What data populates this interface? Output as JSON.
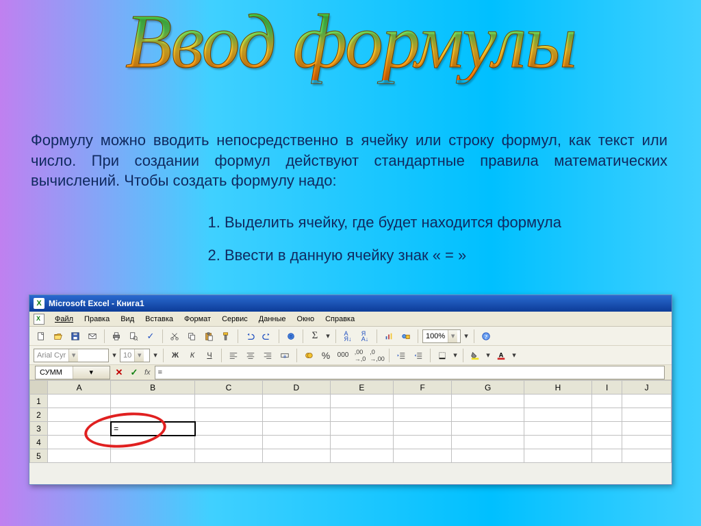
{
  "slide": {
    "title": "Ввод формулы",
    "paragraph": "Формулу можно вводить непосредственно в ячейку или строку формул, как текст или число. При создании формул действуют стандартные правила математических вычислений. Чтобы создать формулу надо:",
    "list": [
      "Выделить ячейку, где будет находится формула",
      "Ввести в данную ячейку знак « = »"
    ]
  },
  "excel": {
    "title": "Microsoft Excel - Книга1",
    "menu": [
      "Файл",
      "Правка",
      "Вид",
      "Вставка",
      "Формат",
      "Сервис",
      "Данные",
      "Окно",
      "Справка"
    ],
    "menu_underline_index": [
      0,
      0,
      0,
      3,
      2,
      0,
      3,
      0,
      0
    ],
    "zoom": "100%",
    "font_name": "Arial Cyr",
    "font_size": "10",
    "namebox": "СУММ",
    "fx_label": "fx",
    "formula_bar_value": "=",
    "columns": [
      "A",
      "B",
      "C",
      "D",
      "E",
      "F",
      "G",
      "H",
      "I",
      "J"
    ],
    "rows": [
      "1",
      "2",
      "3",
      "4",
      "5"
    ],
    "active_cell": {
      "row": 3,
      "col": "B",
      "value": "="
    },
    "icons": {
      "new": "new-file-icon",
      "open": "open-folder-icon",
      "save": "save-icon",
      "mail": "mail-icon",
      "print": "print-icon",
      "preview": "print-preview-icon",
      "spell": "spellcheck-icon",
      "cut": "cut-icon",
      "copy": "copy-icon",
      "paste": "paste-icon",
      "fmtpaint": "format-painter-icon",
      "undo": "undo-icon",
      "redo": "redo-icon",
      "link": "hyperlink-icon",
      "sum": "autosum-icon",
      "sortasc": "sort-asc-icon",
      "sortdesc": "sort-desc-icon",
      "chart": "chart-wizard-icon",
      "drawing": "drawing-icon",
      "help": "help-icon",
      "bold": "bold-icon",
      "italic": "italic-icon",
      "underline": "underline-icon",
      "alignl": "align-left-icon",
      "alignc": "align-center-icon",
      "alignr": "align-right-icon",
      "merge": "merge-center-icon",
      "currency": "currency-icon",
      "percent": "percent-icon",
      "comma": "comma-style-icon",
      "decinc": "increase-decimal-icon",
      "decdec": "decrease-decimal-icon",
      "indentdec": "decrease-indent-icon",
      "indentinc": "increase-indent-icon",
      "borders": "borders-icon",
      "fill": "fill-color-icon",
      "fontcolor": "font-color-icon"
    }
  }
}
